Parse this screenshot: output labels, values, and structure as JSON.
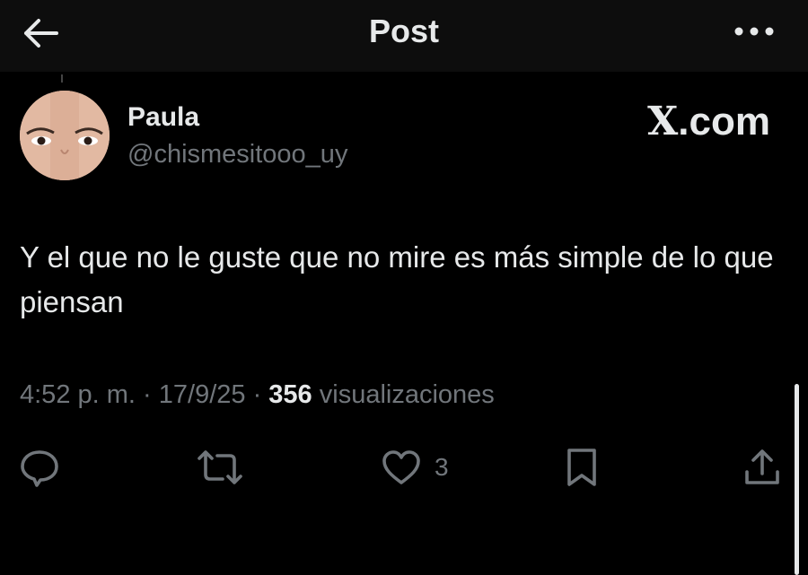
{
  "header": {
    "title": "Post",
    "back_icon": "arrow-left-icon",
    "more_icon": "more-horizontal-icon"
  },
  "author": {
    "display_name": "Paula",
    "handle": "@chismesitooo_uy"
  },
  "watermark": {
    "logo": "X",
    "text": ".com"
  },
  "post": {
    "text": "Y el que no le guste que no mire es más simple de lo que piensan"
  },
  "meta": {
    "time": "4:52 p. m.",
    "sep1": " · ",
    "date": "17/9/25",
    "sep2": " · ",
    "views_count": "356",
    "views_label": " visualizaciones"
  },
  "actions": {
    "reply_icon": "reply-icon",
    "repost_icon": "repost-icon",
    "like_icon": "heart-icon",
    "like_count": "3",
    "bookmark_icon": "bookmark-icon",
    "share_icon": "share-icon"
  },
  "colors": {
    "background": "#000000",
    "header_background": "#0d0d0d",
    "text_primary": "#e7e9ea",
    "text_secondary": "#71767b"
  }
}
